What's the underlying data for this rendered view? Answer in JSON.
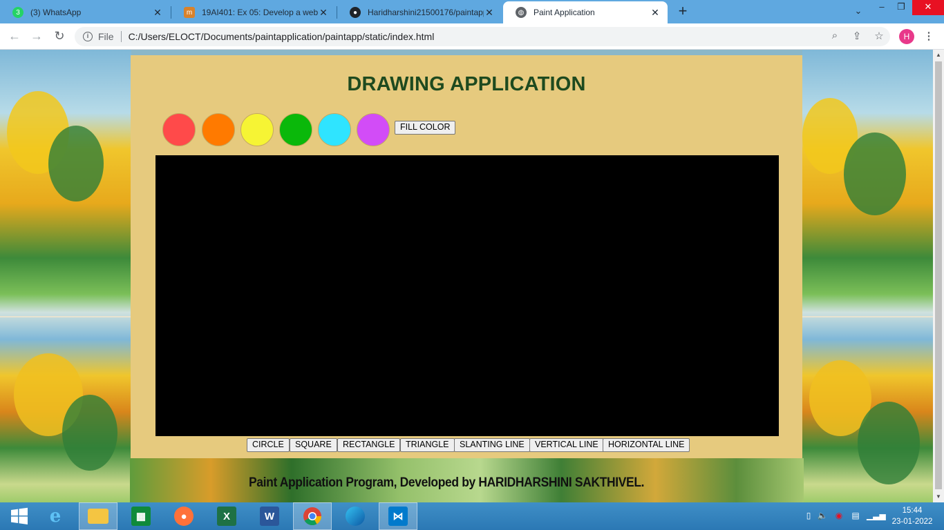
{
  "browser": {
    "tabs": [
      {
        "title": "(3) WhatsApp",
        "favicon": "whatsapp-icon",
        "active": false
      },
      {
        "title": "19AI401: Ex 05: Develop a webpa",
        "favicon": "moodle-icon",
        "active": false
      },
      {
        "title": "Haridharshini21500176/paintapp",
        "favicon": "github-icon",
        "active": false
      },
      {
        "title": "Paint Application",
        "favicon": "globe-icon",
        "active": true
      }
    ],
    "address": {
      "scheme_label": "File",
      "url": "C:/Users/ELOCT/Documents/paintapplication/paintapp/static/index.html"
    },
    "profile_initial": "H"
  },
  "page": {
    "title": "DRAWING APPLICATION",
    "colors": [
      {
        "name": "red",
        "hex": "#ff4a4a"
      },
      {
        "name": "orange",
        "hex": "#ff7a00"
      },
      {
        "name": "yellow",
        "hex": "#f6f434"
      },
      {
        "name": "green",
        "hex": "#0ab80a"
      },
      {
        "name": "cyan",
        "hex": "#2fe4ff"
      },
      {
        "name": "purple",
        "hex": "#d24cf7"
      }
    ],
    "fill_button": "FILL COLOR",
    "canvas_color": "#000000",
    "shape_buttons": [
      "CIRCLE",
      "SQUARE",
      "RECTANGLE",
      "TRIANGLE",
      "SLANTING LINE",
      "VERTICAL LINE",
      "HORIZONTAL LINE"
    ],
    "footer": "Paint Application Program, Developed by HARIDHARSHINI SAKTHIVEL."
  },
  "taskbar": {
    "apps": [
      "windows-start-icon",
      "internet-explorer-icon",
      "file-explorer-icon",
      "store-icon",
      "firefox-icon",
      "excel-icon",
      "word-icon",
      "chrome-icon",
      "edge-icon",
      "vscode-icon"
    ],
    "time": "15:44",
    "date": "23-01-2022"
  }
}
